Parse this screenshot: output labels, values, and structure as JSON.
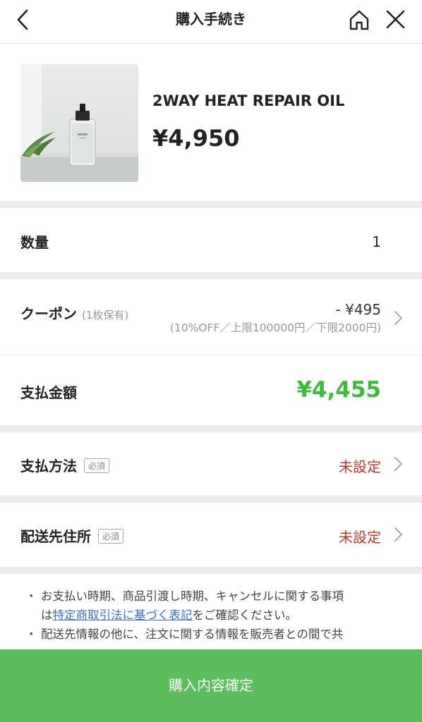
{
  "header": {
    "title": "購入手続き",
    "back_icon": "chevron-left-icon",
    "home_icon": "home-icon",
    "close_icon": "close-icon"
  },
  "product": {
    "name": "2WAY HEAT REPAIR OIL",
    "price": "¥4,950"
  },
  "quantity": {
    "label": "数量",
    "value": "1"
  },
  "coupon": {
    "label": "クーポン",
    "held": "(1枚保有)",
    "discount": "- ¥495",
    "detail": "(10%OFF／上限100000円／下限2000円)"
  },
  "total": {
    "label": "支払金額",
    "value": "¥4,455",
    "color": "#3dbb3d"
  },
  "payment_method": {
    "label": "支払方法",
    "badge": "必須",
    "status": "未設定",
    "status_color": "#c0392b"
  },
  "shipping": {
    "label": "配送先住所",
    "badge": "必須",
    "status": "未設定",
    "status_color": "#c0392b"
  },
  "notes": {
    "bullet": "・",
    "line1": "お支払い時期、商品引渡し時期、キャンセルに関する事項",
    "line2_prefix": "は",
    "line2_link": "特定商取引法に基づく表記",
    "line2_suffix": "をご確認ください。",
    "line3": "配送先情報の他に、注文に関する情報を販売者との間で共"
  },
  "confirm_button": {
    "label": "購入内容確定",
    "color": "#5cbd5c"
  }
}
